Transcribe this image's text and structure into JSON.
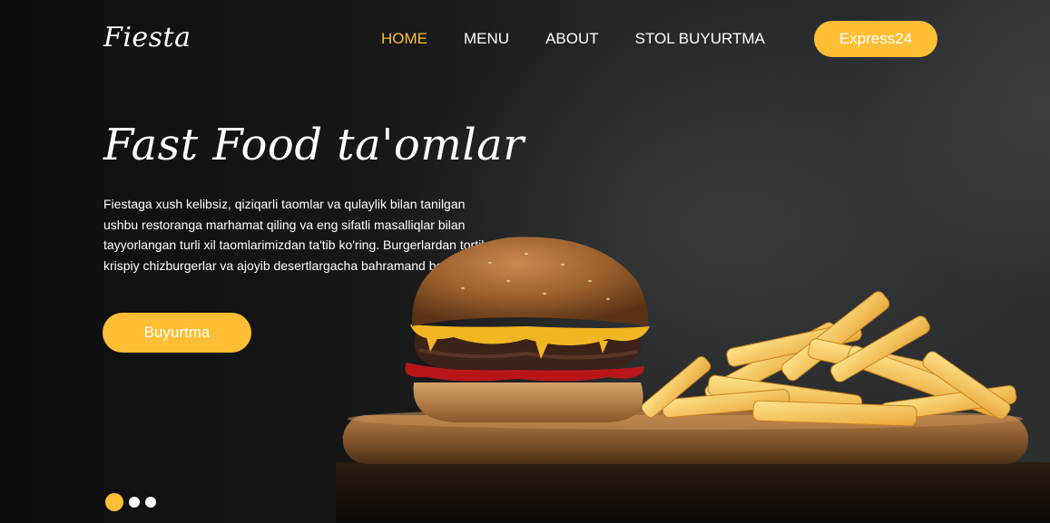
{
  "brand": {
    "logo_text": "Fiesta"
  },
  "nav": {
    "items": [
      {
        "label": "HOME",
        "active": true
      },
      {
        "label": "MENU",
        "active": false
      },
      {
        "label": "ABOUT",
        "active": false
      },
      {
        "label": "STOL BUYURTMA",
        "active": false
      }
    ],
    "cta_label": "Express24"
  },
  "hero": {
    "title": "Fast Food ta'omlar",
    "description": "Fiestaga xush kelibsiz, qiziqarli taomlar va qulaylik bilan tanilgan ushbu restoranga marhamat qiling va eng sifatli masalliqlar bilan tayyorlangan turli xil taomlarimizdan ta'tib ko'ring. Burgerlardan tortib, krispiy chizburgerlar va ajoyib desertlargacha bahramand bo'ling.",
    "button_label": "Buyurtma"
  },
  "slider": {
    "total": 3,
    "active_index": 0
  },
  "colors": {
    "accent": "#ffbe33",
    "background": "#141414",
    "text": "#ffffff"
  },
  "image": {
    "subject": "burger-and-fries-on-wooden-board"
  }
}
